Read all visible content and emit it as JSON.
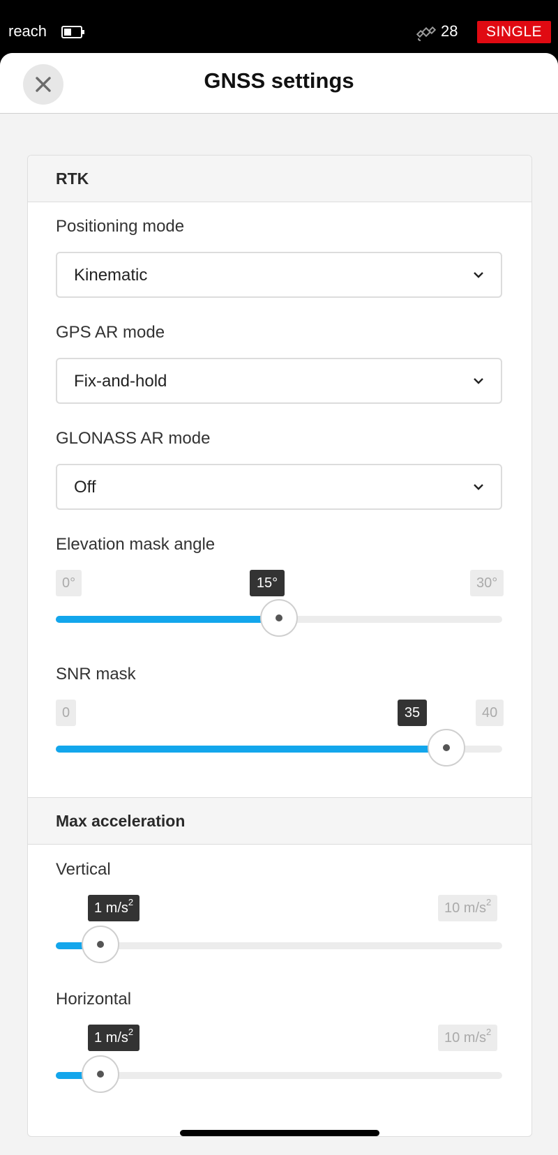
{
  "status_bar": {
    "app_name": "reach",
    "satellite_count": "28",
    "solution_mode": "SINGLE",
    "solution_mode_color": "#e00a12"
  },
  "header": {
    "title": "GNSS settings",
    "close_icon": "close-icon"
  },
  "rtk": {
    "section_title": "RTK",
    "positioning_mode": {
      "label": "Positioning mode",
      "value": "Kinematic"
    },
    "gps_ar_mode": {
      "label": "GPS AR mode",
      "value": "Fix-and-hold"
    },
    "glonass_ar_mode": {
      "label": "GLONASS AR mode",
      "value": "Off"
    },
    "elevation_mask": {
      "label": "Elevation mask angle",
      "min": "0°",
      "max": "30°",
      "current": "15°",
      "level": 0.5
    },
    "snr_mask": {
      "label": "SNR mask",
      "min": "0",
      "max": "40",
      "current": "35",
      "level": 0.875
    }
  },
  "max_acceleration": {
    "section_title": "Max acceleration",
    "vertical": {
      "label": "Vertical",
      "current": "1 m/s",
      "max": "10 m/s",
      "exponent": "2",
      "level": 0.1
    },
    "horizontal": {
      "label": "Horizontal",
      "current": "1 m/s",
      "max": "10 m/s",
      "exponent": "2",
      "level": 0.1
    }
  },
  "accent_color": "#13a6ec"
}
